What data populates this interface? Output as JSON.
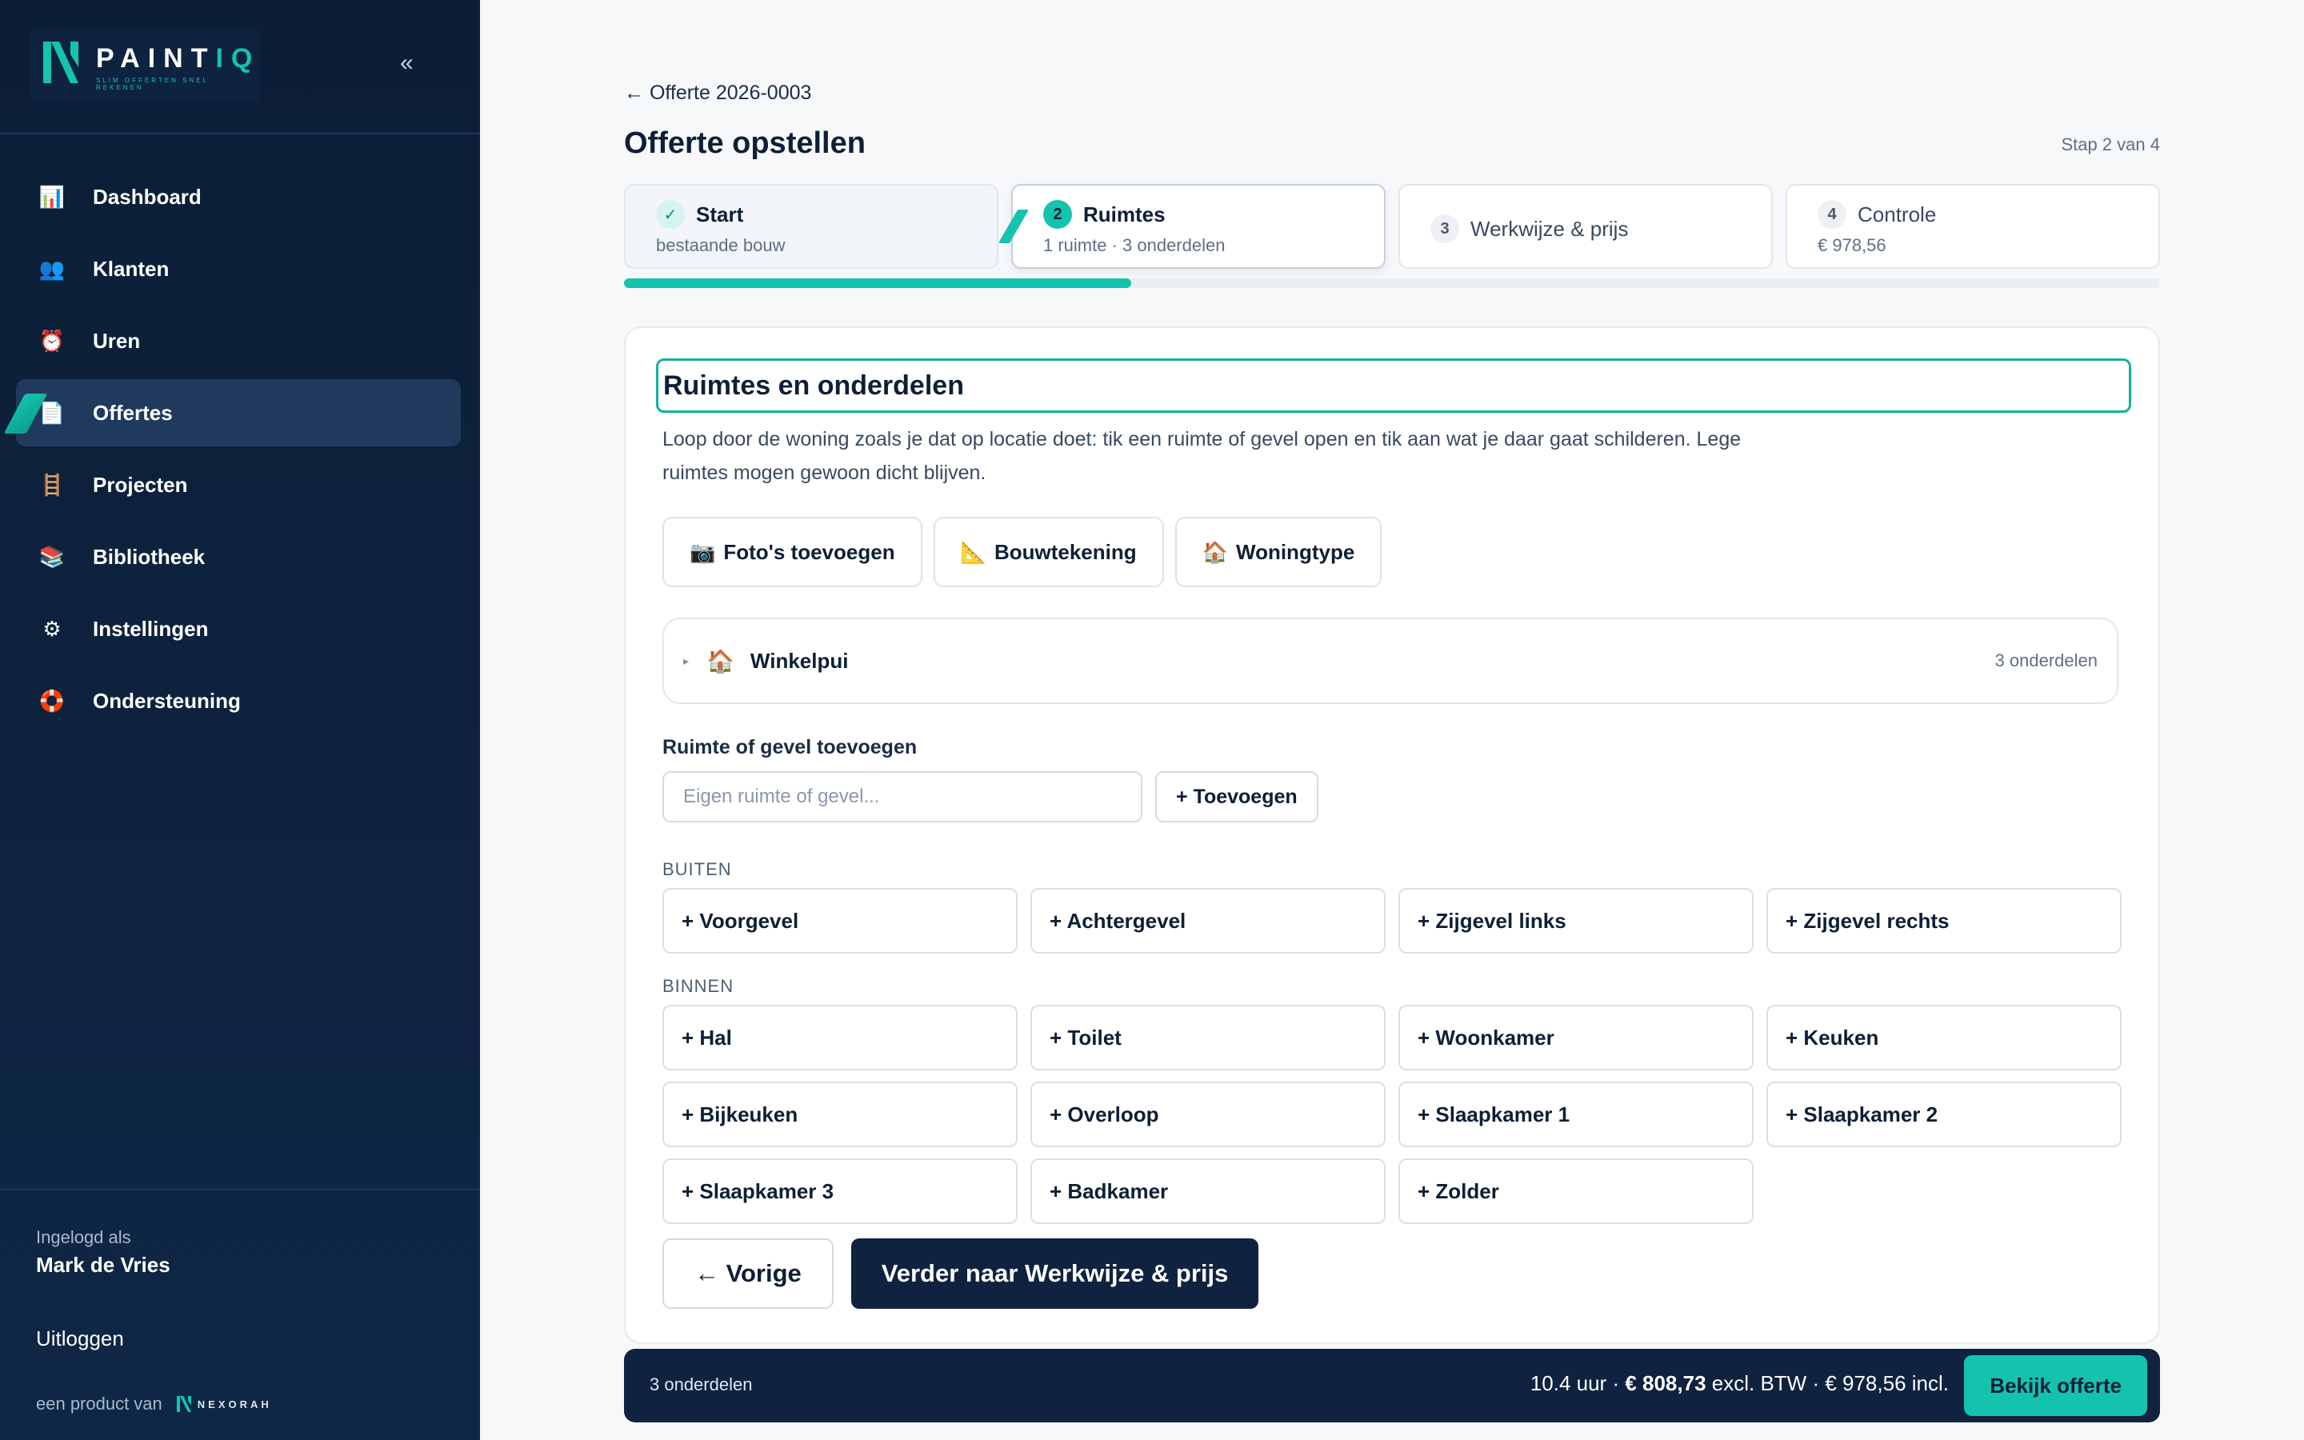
{
  "brand": {
    "name_main": "PAINT",
    "name_accent": "IQ",
    "tagline": "SLIM OFFERTEN SNEL REKENEN",
    "accent_color": "#14c3ae",
    "navy_color": "#0f2240"
  },
  "sidebar": {
    "collapse_label": "«",
    "items": [
      {
        "label": "Dashboard",
        "icon": "bar-chart-icon",
        "glyph": "📊",
        "active": false
      },
      {
        "label": "Klanten",
        "icon": "people-icon",
        "glyph": "👥",
        "active": false
      },
      {
        "label": "Uren",
        "icon": "clock-icon",
        "glyph": "⏰",
        "active": false
      },
      {
        "label": "Offertes",
        "icon": "document-icon",
        "glyph": "📄",
        "active": true
      },
      {
        "label": "Projecten",
        "icon": "ladder-icon",
        "glyph": "🪜",
        "active": false
      },
      {
        "label": "Bibliotheek",
        "icon": "books-icon",
        "glyph": "📚",
        "active": false
      },
      {
        "label": "Instellingen",
        "icon": "gear-icon",
        "glyph": "⚙",
        "active": false
      },
      {
        "label": "Ondersteuning",
        "icon": "lifebuoy-icon",
        "glyph": "🛟",
        "active": false
      }
    ],
    "logged_in_label": "Ingelogd als",
    "user_name": "Mark de Vries",
    "logout_label": "Uitloggen",
    "product_of_label": "een product van",
    "product_brand": "NEXORAH"
  },
  "header": {
    "back_label": "← Offerte 2026-0003",
    "title": "Offerte opstellen",
    "step_count": "Stap 2 van 4"
  },
  "steps": [
    {
      "badge": "✓",
      "label": "Start",
      "sub": "bestaande bouw",
      "state": "done"
    },
    {
      "badge": "2",
      "label": "Ruimtes",
      "sub": "1 ruimte · 3 onderdelen",
      "state": "current"
    },
    {
      "badge": "3",
      "label": "Werkwijze & prijs",
      "sub": "",
      "state": "todo"
    },
    {
      "badge": "4",
      "label": "Controle",
      "sub": "€ 978,56",
      "state": "todo"
    }
  ],
  "progress_percent": 33,
  "card": {
    "title": "Ruimtes en onderdelen",
    "description": "Loop door de woning zoals je dat op locatie doet: tik een ruimte of gevel open en tik aan wat je daar gaat schilderen. Lege ruimtes mogen gewoon dicht blijven.",
    "tools": [
      {
        "glyph": "📷",
        "icon": "camera-icon",
        "label": "Foto's toevoegen"
      },
      {
        "glyph": "📐",
        "icon": "ruler-icon",
        "label": "Bouwtekening"
      },
      {
        "glyph": "🏠",
        "icon": "house-icon",
        "label": "Woningtype"
      }
    ],
    "room": {
      "caret": "▸",
      "glyph": "🏠",
      "name": "Winkelpui",
      "count": "3 onderdelen"
    },
    "add_label": "Ruimte of gevel toevoegen",
    "add_placeholder": "Eigen ruimte of gevel...",
    "add_value": "",
    "add_button": "+ Toevoegen",
    "outside_label": "BUITEN",
    "outside": [
      "+ Voorgevel",
      "+ Achtergevel",
      "+ Zijgevel links",
      "+ Zijgevel rechts"
    ],
    "inside_label": "BINNEN",
    "inside": [
      "+ Hal",
      "+ Toilet",
      "+ Woonkamer",
      "+ Keuken",
      "+ Bijkeuken",
      "+ Overloop",
      "+ Slaapkamer 1",
      "+ Slaapkamer 2",
      "+ Slaapkamer 3",
      "+ Badkamer",
      "+ Zolder"
    ],
    "prev_label": "← Vorige",
    "next_label": "Verder naar Werkwijze & prijs"
  },
  "summary": {
    "parts": "3 onderdelen",
    "hours": "10.4 uur · ",
    "excl": "€ 808,73",
    "excl_suffix": " excl. BTW · € 978,56 incl.",
    "view_label": "Bekijk offerte"
  }
}
